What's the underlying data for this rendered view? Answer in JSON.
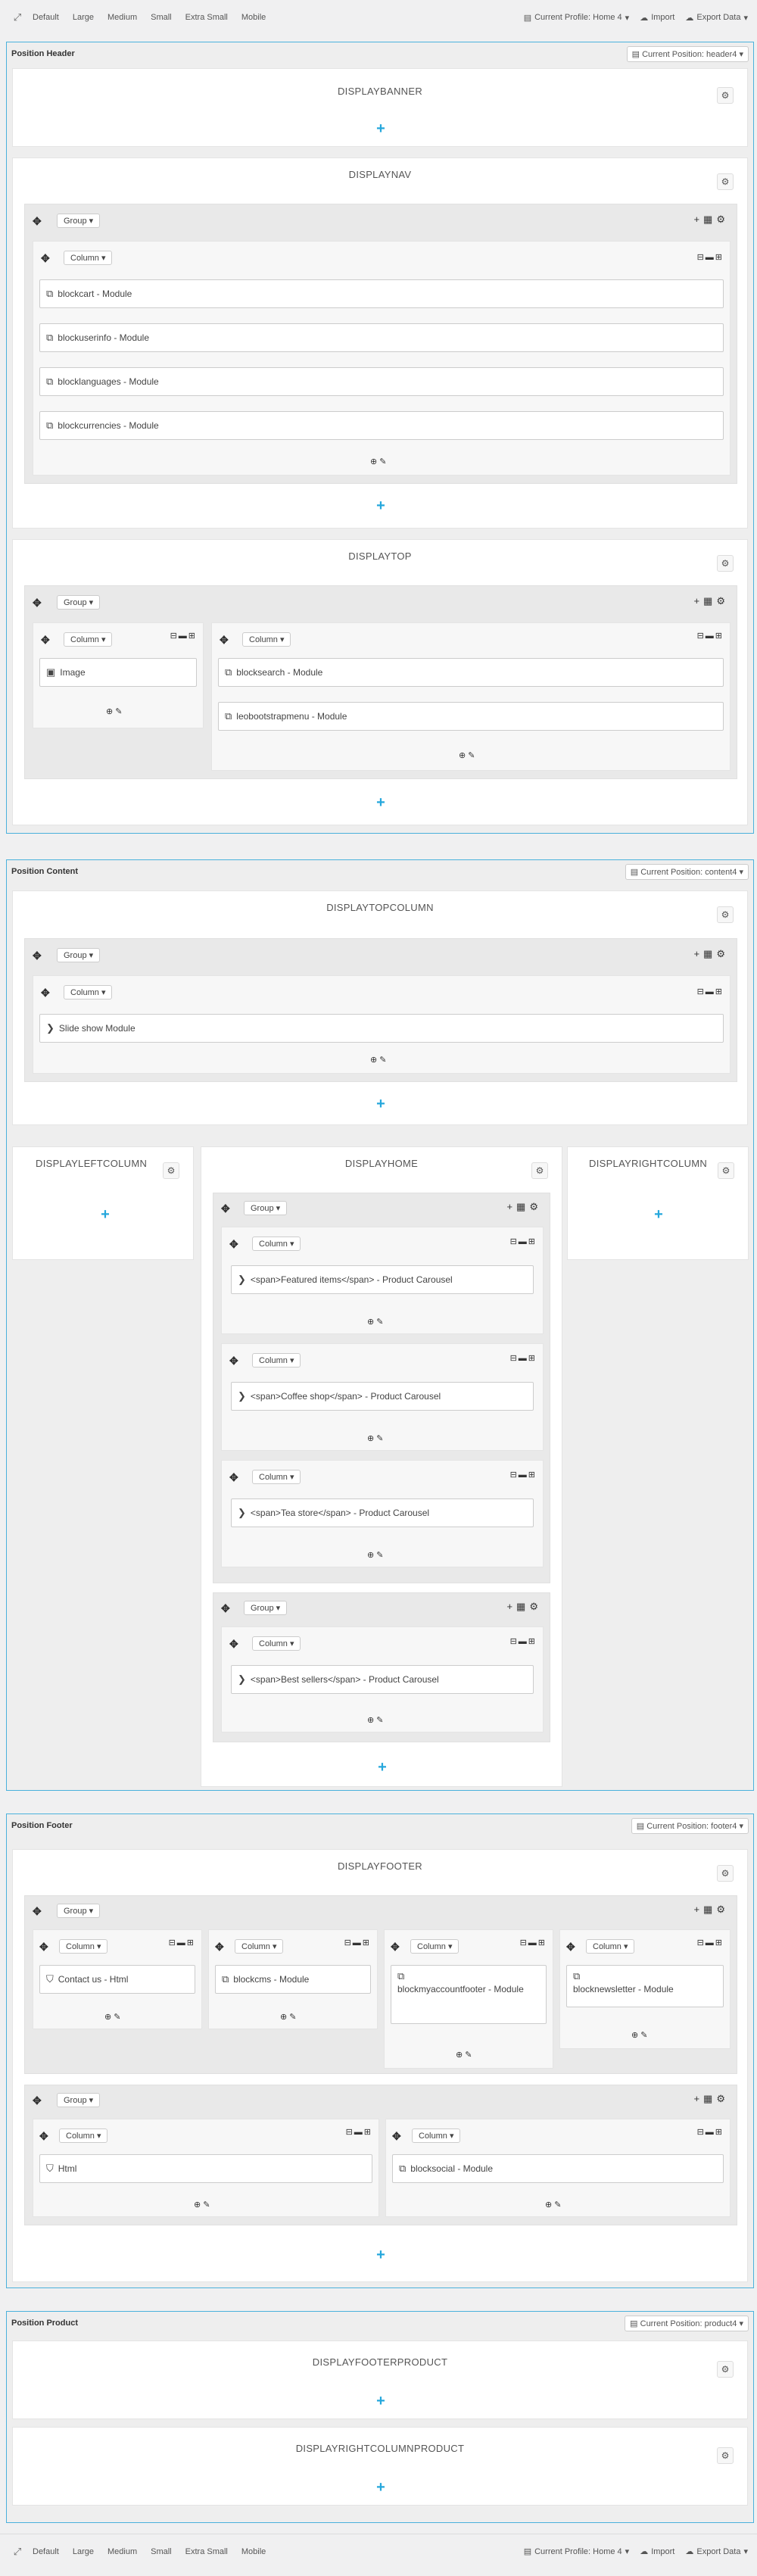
{
  "toolbar": {
    "items": [
      "Default",
      "Large",
      "Medium",
      "Small",
      "Extra Small",
      "Mobile"
    ],
    "profile": "Current Profile: Home 4",
    "import": "Import",
    "export": "Export Data"
  },
  "positions": {
    "header": {
      "title": "Position Header",
      "select": "Current Position: header4"
    },
    "content": {
      "title": "Position Content",
      "select": "Current Position: content4"
    },
    "footer": {
      "title": "Position Footer",
      "select": "Current Position: footer4"
    },
    "product": {
      "title": "Position Product",
      "select": "Current Position: product4"
    }
  },
  "hooks": {
    "banner": "DISPLAYBANNER",
    "nav": "DISPLAYNAV",
    "top": "DISPLAYTOP",
    "topcolumn": "DISPLAYTOPCOLUMN",
    "leftcolumn": "DISPLAYLEFTCOLUMN",
    "home": "DISPLAYHOME",
    "rightcolumn": "DISPLAYRIGHTCOLUMN",
    "footer": "DISPLAYFOOTER",
    "footerproduct": "DISPLAYFOOTERPRODUCT",
    "rightcolumnproduct": "DISPLAYRIGHTCOLUMNPRODUCT"
  },
  "labels": {
    "group": "Group",
    "column": "Column"
  },
  "modules": {
    "nav": [
      "blockcart - Module",
      "blockuserinfo - Module",
      "blocklanguages - Module",
      "blockcurrencies - Module"
    ],
    "top_left": "Image",
    "top_right": [
      "blocksearch - Module",
      "leobootstrapmenu - Module"
    ],
    "topcolumn": "Slide show Module",
    "home": [
      "<span>Featured items</span> - Product Carousel",
      "<span>Coffee shop</span> - Product Carousel",
      "<span>Tea store</span> - Product Carousel",
      "<span>Best sellers</span> - Product Carousel"
    ],
    "footer_row1": [
      "Contact us - Html",
      "blockcms - Module",
      "blockmyaccountfooter - Module",
      "blocknewsletter - Module"
    ],
    "footer_row2": [
      "Html",
      "blocksocial - Module"
    ]
  }
}
